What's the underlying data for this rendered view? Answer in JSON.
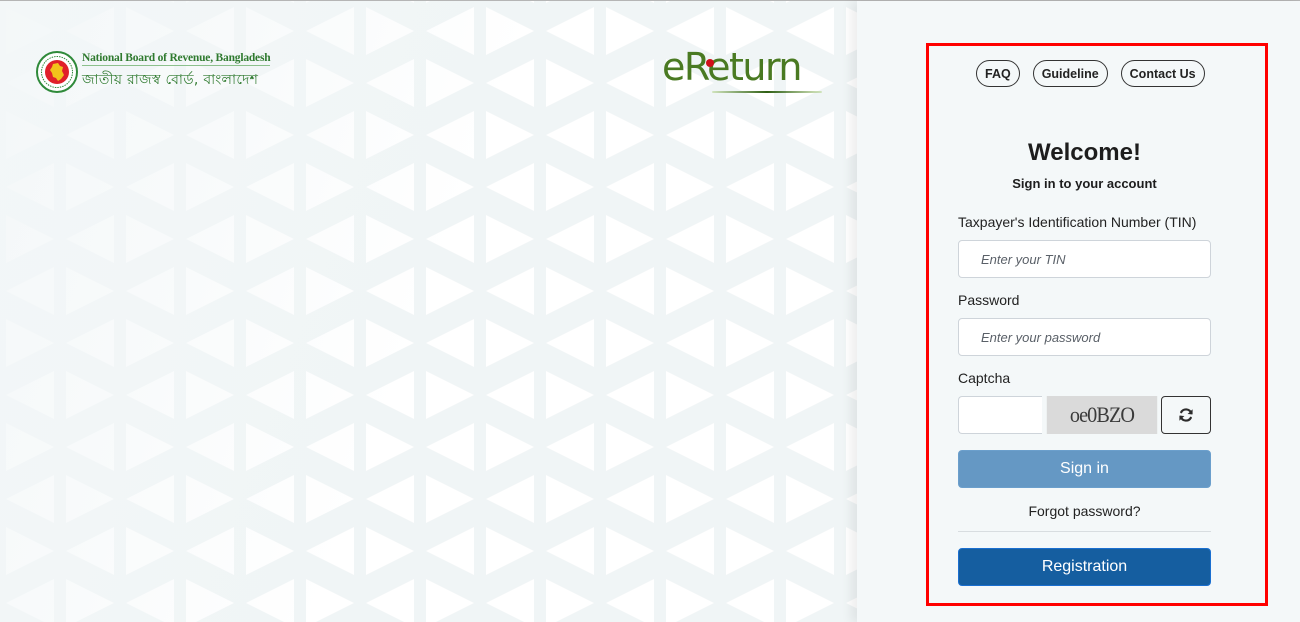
{
  "branding": {
    "org_name_en": "National Board of Revenue, Bangladesh",
    "org_name_bn": "জাতীয় রাজস্ব বোর্ড, বাংলাদেশ",
    "app_logo_text": "eReturn",
    "brand_green": "#4a7a22",
    "logo_dot_red": "#d0101a"
  },
  "top_links": [
    {
      "label": "FAQ"
    },
    {
      "label": "Guideline"
    },
    {
      "label": "Contact Us"
    }
  ],
  "login": {
    "title": "Welcome!",
    "subtitle": "Sign in to your account",
    "tin": {
      "label": "Taxpayer's Identification Number (TIN)",
      "placeholder": "Enter your TIN",
      "value": ""
    },
    "password": {
      "label": "Password",
      "placeholder": "Enter your password",
      "value": ""
    },
    "captcha": {
      "label": "Captcha",
      "value": "",
      "image_text": "oe0BZO",
      "refresh_icon": "refresh-icon"
    },
    "signin_label": "Sign in",
    "forgot_label": "Forgot password?",
    "register_label": "Registration"
  },
  "colors": {
    "signin_button": "#6598c4",
    "register_button": "#155ea0",
    "highlight_border": "#ff0000"
  }
}
